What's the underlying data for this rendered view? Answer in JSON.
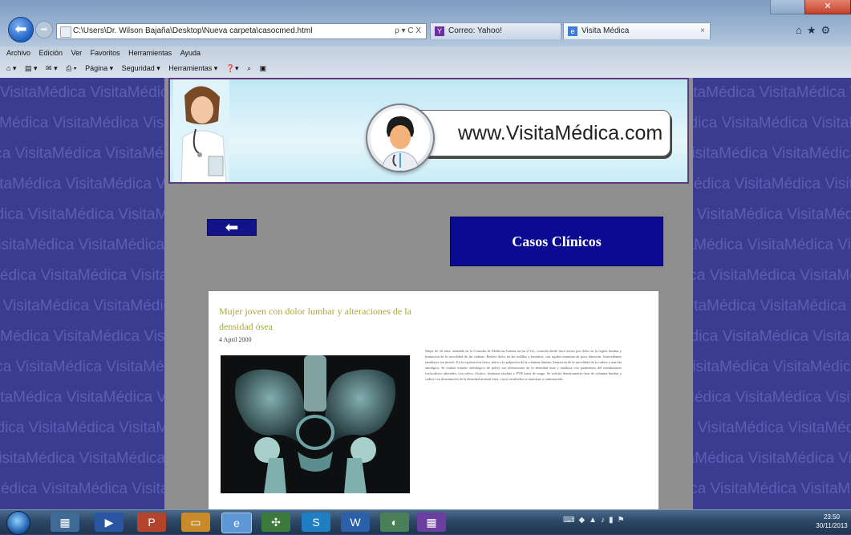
{
  "browser": {
    "address_url": "C:\\Users\\Dr. Wilson Bajaña\\Desktop\\Nueva carpeta\\casocmed.html",
    "address_tools": "ρ ▾ C X",
    "tabs": [
      {
        "label": "Correo: Yahoo!",
        "favicon": "yahoo-mail-icon"
      },
      {
        "label": "Visita Médica",
        "favicon": "ie-page-icon",
        "active": true
      }
    ],
    "menu": [
      "Archivo",
      "Edición",
      "Ver",
      "Favoritos",
      "Herramientas",
      "Ayuda"
    ],
    "command_bar": [
      "Página ▾",
      "Seguridad ▾",
      "Herramientas ▾"
    ]
  },
  "watermark_text": "VisitaMédica",
  "header": {
    "site_url": "www.VisitaMédica.com"
  },
  "nav": {
    "back_arrow": "⬅"
  },
  "section": {
    "title": "Casos Clínicos"
  },
  "article": {
    "title": "Mujer joven con dolor lumbar y alteraciones de la densidad ósea",
    "date": "4 April 2000",
    "body": "Mujer de 32 años, atendida en la Consulta de Medicina Interna en las 2-12c, consulta desde hace meses por dolor en la región lumbar y limitación de la movilidad de las caderas. Refiere dolor en las rodillas y hombros, con rigidez matutina de poca duración. Antecedentes familiares sin interés. En la exploración física, dolor a la palpación de la columna lumbar, limitación de la movilidad de la cadera y marcha antiálgica. Se realizó estudio radiológico de pelvis con alteraciones de la densidad ósea y analítica con parámetros del metabolismo fosfocálcico alterados, con calcio, fósforo, fosfatasa alcalina y PTH fuera de rango. Se solicitó densitometría ósea de columna lumbar y cadera con disminución de la densidad mineral ósea, cuyos resultados se muestran a continuación."
  },
  "taskbar": {
    "clock_time": "23:50",
    "clock_date": "30/11/2013"
  }
}
